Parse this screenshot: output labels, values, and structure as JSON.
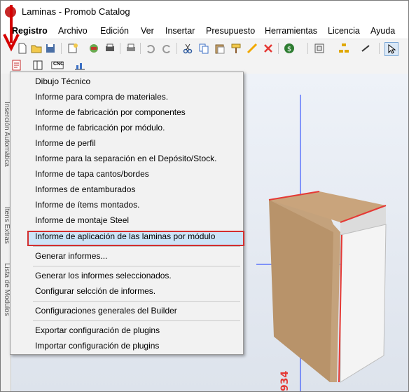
{
  "window": {
    "title": "Laminas - Promob Catalog"
  },
  "menubar": {
    "items": [
      "Registro",
      "Archivo",
      "Edición",
      "Ver",
      "Insertar",
      "Presupuesto",
      "Herramientas",
      "Licencia",
      "Ayuda"
    ]
  },
  "toolbar2": {
    "cnc_label": "CNC"
  },
  "side_tabs": {
    "tab1": "Inserción Automática",
    "tab2": "Ítens Extras",
    "tab3": "Lista de Modulos"
  },
  "dropdown": {
    "items": [
      "Dibujo Técnico",
      "Informe para compra de materiales.",
      "Informe de fabricación por componentes",
      "Informe de fabricación por módulo.",
      "Informe de perfil",
      "Informe para la separación en el Depósito/Stock.",
      "Informe de tapa cantos/bordes",
      "Informes de entamburados",
      "Informe de ítems montados.",
      "Informe de montaje Steel",
      "Informe de aplicación de las laminas por módulo",
      "Generar informes...",
      "Generar los informes seleccionados.",
      "Configurar selcción de informes.",
      "Configuraciones generales del Builder",
      "Exportar configuración de plugins",
      "Importar configuración de plugins"
    ],
    "highlighted_index": 10
  },
  "viewport": {
    "dimension_text": "934"
  },
  "colors": {
    "highlight_border": "#d32f2f",
    "highlight_fill": "#cde4f7",
    "axis_blue": "#1a3cff",
    "arrow_red": "#d50000"
  }
}
